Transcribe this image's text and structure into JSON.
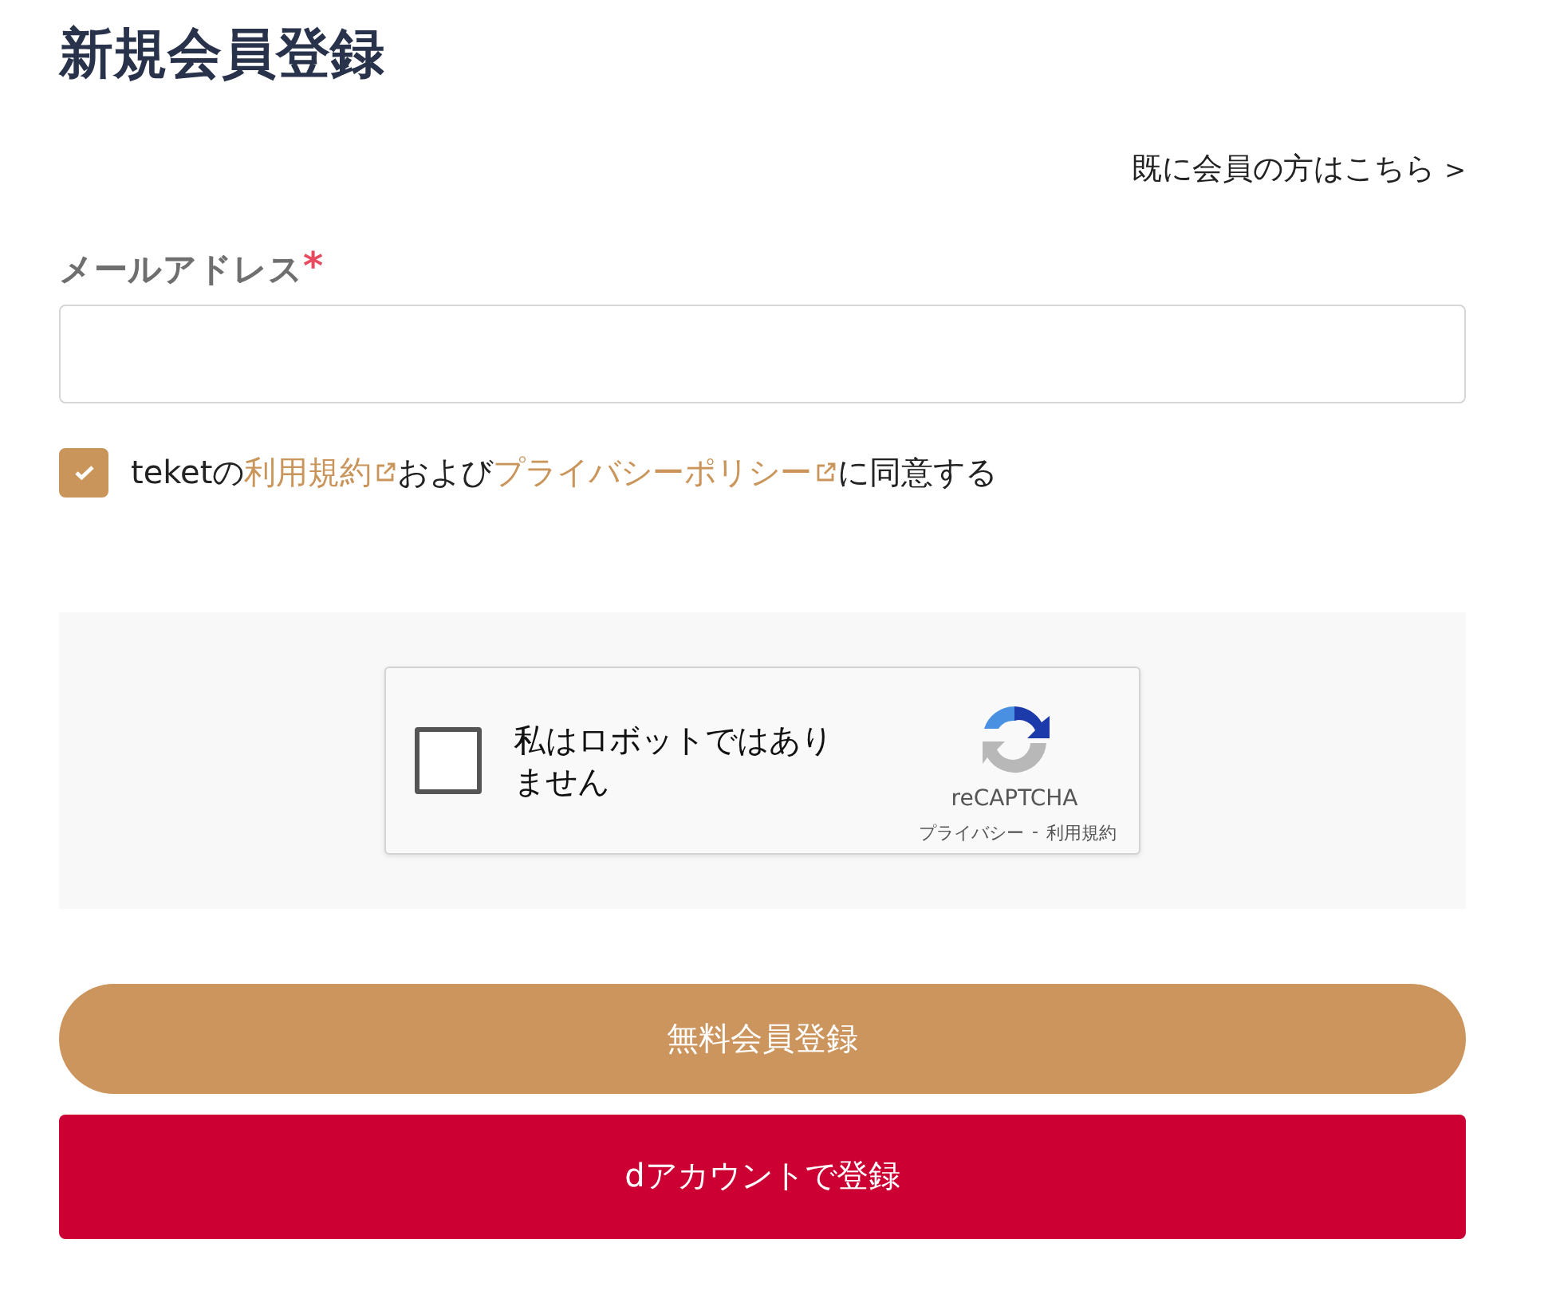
{
  "title": "新規会員登録",
  "login_link": {
    "text": "既に会員の方はこちら",
    "arrow": ">"
  },
  "email": {
    "label": "メールアドレス",
    "required_mark": "*"
  },
  "agreement": {
    "checked": true,
    "parts": [
      {
        "kind": "text",
        "text": "teketの"
      },
      {
        "kind": "link",
        "text": "利用規約"
      },
      {
        "kind": "text",
        "text": "および"
      },
      {
        "kind": "link",
        "text": "プライバシーポリシー"
      },
      {
        "kind": "text",
        "text": "に同意する"
      }
    ]
  },
  "captcha": {
    "label": "私はロボットではありません",
    "checked": false,
    "brand": "reCAPTCHA",
    "links": [
      "プライバシー",
      "利用規約"
    ],
    "separator": "-"
  },
  "buttons": [
    {
      "kind": "primary",
      "label": "無料会員登録"
    },
    {
      "kind": "daccount",
      "label": "dアカウントで登録"
    }
  ]
}
